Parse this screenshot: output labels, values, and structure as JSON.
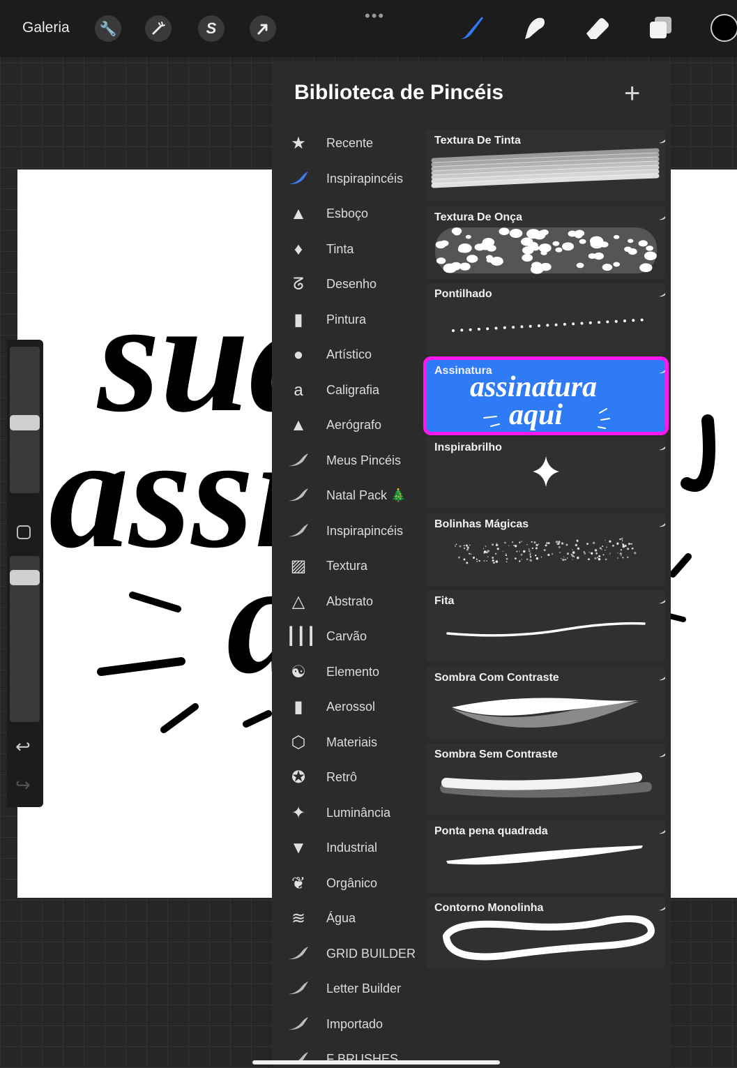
{
  "app": {
    "gallery_label": "Galeria",
    "more_dots": "•••"
  },
  "panel": {
    "title": "Biblioteca de Pincéis",
    "add_label": "+"
  },
  "categories": [
    {
      "label": "Recente",
      "icon": "star-icon",
      "glyph": "★"
    },
    {
      "label": "Inspirapincéis",
      "icon": "brush-stroke-icon",
      "glyph": "",
      "accent": "#3d7cf5"
    },
    {
      "label": "Esboço",
      "icon": "pencil-icon",
      "glyph": "▲"
    },
    {
      "label": "Tinta",
      "icon": "ink-drop-icon",
      "glyph": "♦"
    },
    {
      "label": "Desenho",
      "icon": "squiggle-icon",
      "glyph": "ᘔ"
    },
    {
      "label": "Pintura",
      "icon": "paintbrush-icon",
      "glyph": "▮"
    },
    {
      "label": "Artístico",
      "icon": "palette-icon",
      "glyph": "●"
    },
    {
      "label": "Caligrafia",
      "icon": "calligraphy-icon",
      "glyph": "a"
    },
    {
      "label": "Aerógrafo",
      "icon": "airbrush-icon",
      "glyph": "▲"
    },
    {
      "label": "Meus Pincéis",
      "icon": "brush-stroke-icon",
      "glyph": ""
    },
    {
      "label": "Natal Pack 🎄",
      "icon": "brush-stroke-icon",
      "glyph": ""
    },
    {
      "label": "Inspirapincéis",
      "icon": "brush-stroke-icon",
      "glyph": ""
    },
    {
      "label": "Textura",
      "icon": "texture-icon",
      "glyph": "▨"
    },
    {
      "label": "Abstrato",
      "icon": "triangle-icon",
      "glyph": "△"
    },
    {
      "label": "Carvão",
      "icon": "charcoal-icon",
      "glyph": "┃┃┃"
    },
    {
      "label": "Elemento",
      "icon": "yin-yang-icon",
      "glyph": "☯"
    },
    {
      "label": "Aerossol",
      "icon": "spray-can-icon",
      "glyph": "▮"
    },
    {
      "label": "Materiais",
      "icon": "cube-icon",
      "glyph": "⬡"
    },
    {
      "label": "Retrô",
      "icon": "retro-star-icon",
      "glyph": "✪"
    },
    {
      "label": "Luminância",
      "icon": "sparkle-icon",
      "glyph": "✦"
    },
    {
      "label": "Industrial",
      "icon": "anvil-icon",
      "glyph": "▼"
    },
    {
      "label": "Orgânico",
      "icon": "leaf-icon",
      "glyph": "❦"
    },
    {
      "label": "Água",
      "icon": "waves-icon",
      "glyph": "≋"
    },
    {
      "label": "GRID BUILDER",
      "icon": "brush-stroke-icon",
      "glyph": ""
    },
    {
      "label": "Letter Builder",
      "icon": "brush-stroke-icon",
      "glyph": ""
    },
    {
      "label": "Importado",
      "icon": "brush-stroke-icon",
      "glyph": ""
    },
    {
      "label": "F BRUSHES",
      "icon": "brush-stroke-icon",
      "glyph": ""
    }
  ],
  "brushes": [
    {
      "name": "Textura De Tinta",
      "preview": "ink-texture"
    },
    {
      "name": "Textura De Onça",
      "preview": "leopard"
    },
    {
      "name": "Pontilhado",
      "preview": "dots"
    },
    {
      "name": "Assinatura",
      "preview": "signature",
      "selected": true,
      "preview_line1": "assinatura",
      "preview_line2": "aqui"
    },
    {
      "name": "Inspirabrilho",
      "preview": "sparkle"
    },
    {
      "name": "Bolinhas Mágicas",
      "preview": "glitter"
    },
    {
      "name": "Fita",
      "preview": "ribbon"
    },
    {
      "name": "Sombra Com Contraste",
      "preview": "shadow-contrast"
    },
    {
      "name": "Sombra Sem Contraste",
      "preview": "shadow-no-contrast"
    },
    {
      "name": "Ponta pena quadrada",
      "preview": "square-nib"
    },
    {
      "name": "Contorno Monolinha",
      "preview": "monoline-outline"
    }
  ],
  "canvas_text": {
    "line1": "sua",
    "line2": "assi",
    "line3": "a"
  },
  "colors": {
    "accent": "#2f7bf5",
    "highlight": "#ff18f0",
    "current_color": "#000000"
  }
}
